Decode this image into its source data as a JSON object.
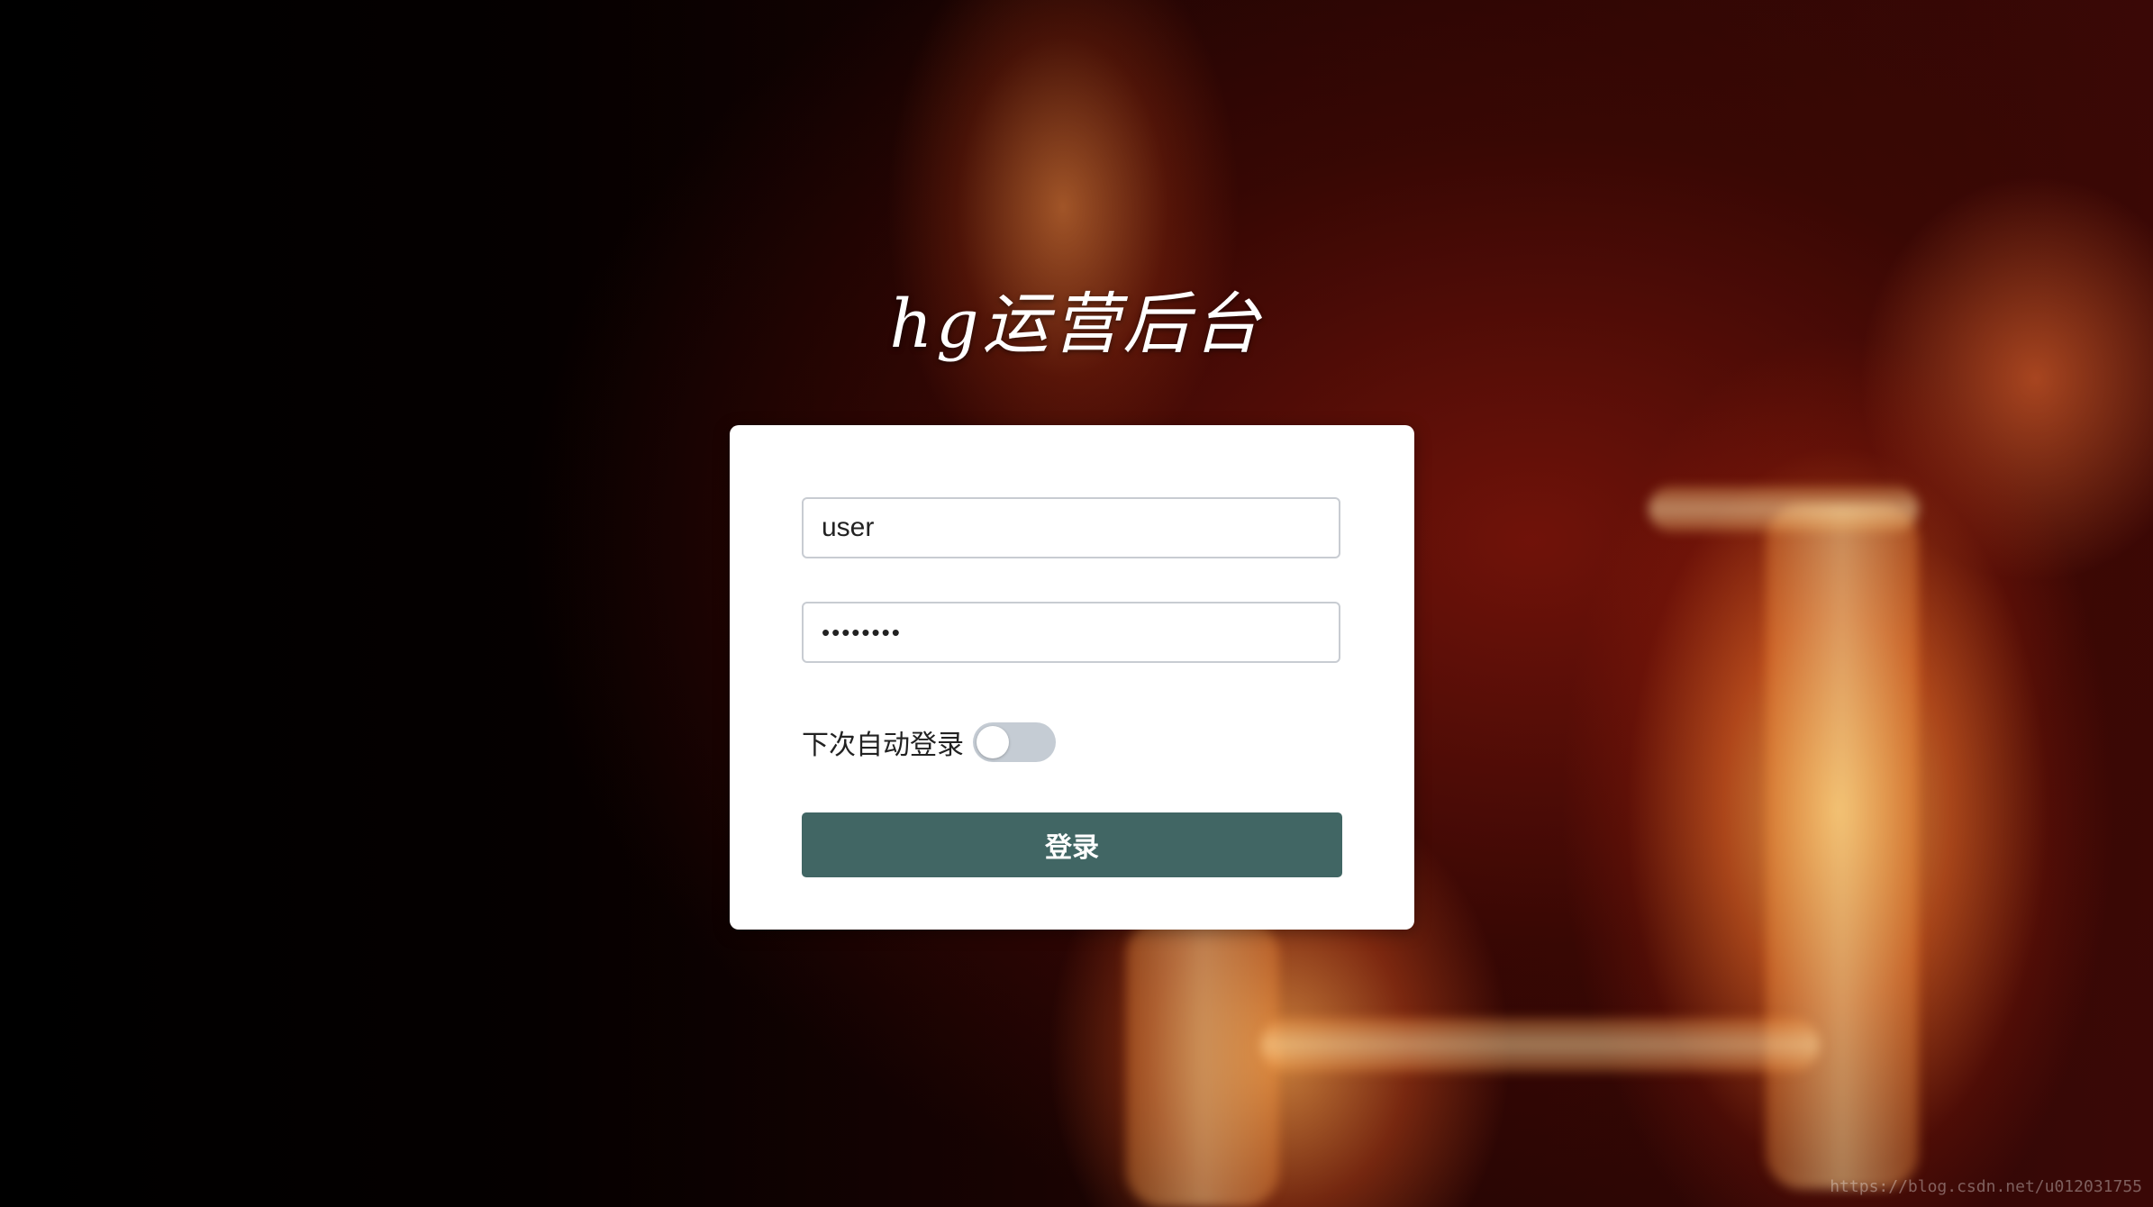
{
  "page": {
    "title": "hg运营后台"
  },
  "login_form": {
    "username_value": "user",
    "password_mask": "••••••••",
    "remember_label": "下次自动登录",
    "remember_on": false,
    "submit_label": "登录"
  },
  "watermark": {
    "text": "https://blog.csdn.net/u012031755"
  },
  "colors": {
    "button_bg": "#416664",
    "toggle_off": "#c5ccd4",
    "card_bg": "#ffffff"
  }
}
